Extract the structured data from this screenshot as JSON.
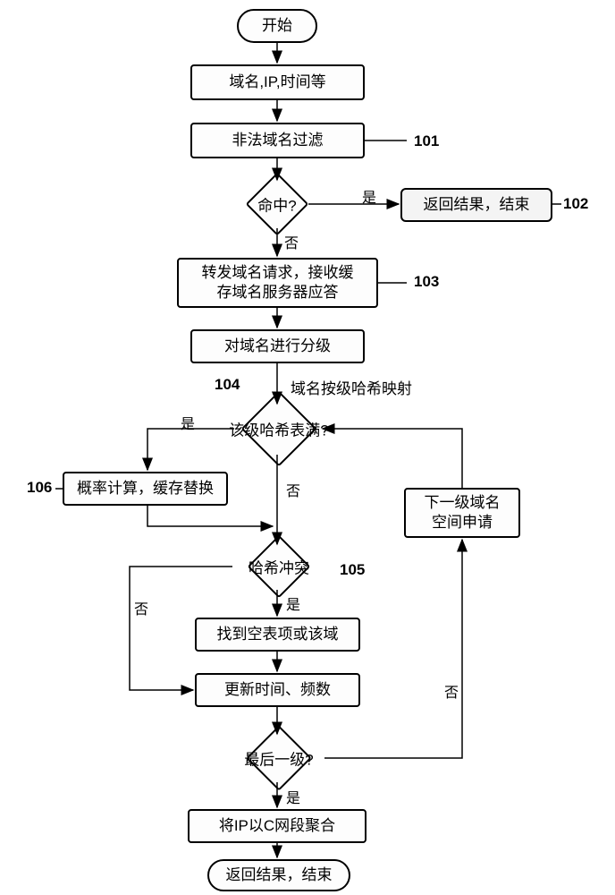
{
  "nodes": {
    "start": "开始",
    "input": "域名,IP,时间等",
    "filter": "非法域名过滤",
    "hit": "命中?",
    "return1": "返回结果，结束",
    "forward": "转发域名请求，接收缓\n存域名服务器应答",
    "level": "对域名进行分级",
    "hashfull": "该级哈希表满?",
    "prob": "概率计算，缓存替换",
    "conflict": "哈希冲突",
    "findempty": "找到空表项或该域",
    "update": "更新时间、频数",
    "last": "最后一级?",
    "nextspace": "下一级域名\n空间申请",
    "ipagg": "将IP以C网段聚合",
    "end": "返回结果，结束"
  },
  "labels": {
    "l101": "101",
    "l102": "102",
    "l103": "103",
    "l104": "104",
    "l105": "105",
    "l106": "106",
    "hashmap": "域名按级哈希映射"
  },
  "edges": {
    "yes": "是",
    "no": "否"
  }
}
